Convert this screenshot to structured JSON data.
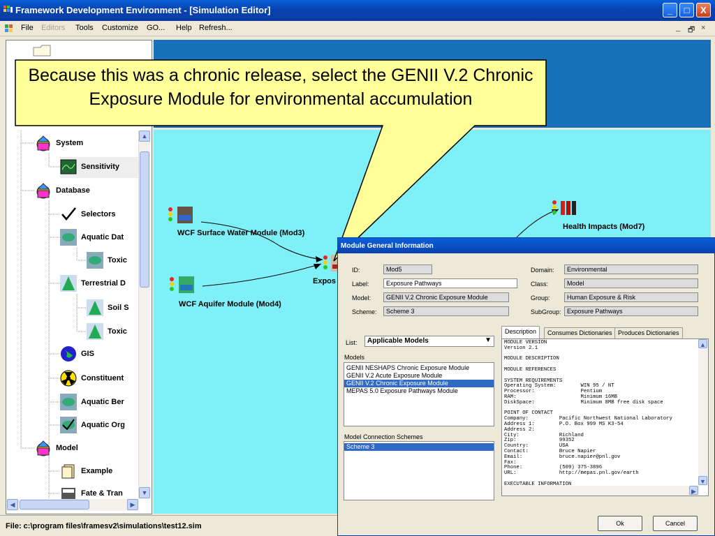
{
  "window": {
    "title": "Framework Development Environment - [Simulation Editor]",
    "minimize": "_",
    "maximize": "□",
    "close": "X"
  },
  "menu": {
    "items": [
      {
        "label": "File",
        "disabled": false
      },
      {
        "label": "Editors",
        "disabled": true
      },
      {
        "label": "Tools",
        "disabled": false
      },
      {
        "label": "Customize",
        "disabled": false
      },
      {
        "label": "GO...",
        "disabled": false
      },
      {
        "label": "Help",
        "disabled": false
      },
      {
        "label": "Refresh...",
        "disabled": false
      }
    ],
    "mdi_min": "_",
    "mdi_restore": "🗗",
    "mdi_close": "×"
  },
  "tree": {
    "items": [
      {
        "label": "System",
        "icon": "system-icon"
      },
      {
        "label": "Sensitivity",
        "icon": "sensitivity-icon"
      },
      {
        "label": "Database",
        "icon": "database-icon"
      },
      {
        "label": "Selectors",
        "icon": "checkmark-icon"
      },
      {
        "label": "Aquatic Dat",
        "icon": "fish-icon"
      },
      {
        "label": "Toxic",
        "icon": "fish-icon"
      },
      {
        "label": "Terrestrial D",
        "icon": "tree-icon"
      },
      {
        "label": "Soil S",
        "icon": "tree-icon"
      },
      {
        "label": "Toxic",
        "icon": "tree-icon"
      },
      {
        "label": "GIS",
        "icon": "globe-icon"
      },
      {
        "label": "Constituent",
        "icon": "radiation-icon"
      },
      {
        "label": "Aquatic Ber",
        "icon": "fish-icon"
      },
      {
        "label": "Aquatic Org",
        "icon": "fish-icon"
      },
      {
        "label": "Model",
        "icon": "model-icon"
      },
      {
        "label": "Example",
        "icon": "example-icon"
      },
      {
        "label": "Fate & Tran",
        "icon": "fate-icon"
      }
    ]
  },
  "canvas": {
    "nodes": [
      {
        "label": "WCF Surface Water Module (Mod3)"
      },
      {
        "label": "WCF Aquifer Module (Mod4)"
      },
      {
        "label": "Expos"
      },
      {
        "label": "Health Impacts (Mod7)"
      }
    ]
  },
  "callout": {
    "text": "Because this was a chronic release, select the GENII V.2 Chronic Exposure Module for environmental accumulation"
  },
  "status": {
    "text": "File: c:\\program files\\framesv2\\simulations\\test12.sim"
  },
  "dialog": {
    "title": "Module General Information",
    "fields": {
      "id_label": "ID:",
      "id": "Mod5",
      "label_label": "Label:",
      "label": "Exposure Pathways",
      "model_label": "Model:",
      "model": "GENII V.2 Chronic Exposure Module",
      "scheme_label": "Scheme:",
      "scheme": "Scheme 3",
      "domain_label": "Domain:",
      "domain": "Environmental",
      "class_label": "Class:",
      "class": "Model",
      "group_label": "Group:",
      "group": "Human Exposure & Risk",
      "subgroup_label": "SubGroup:",
      "subgroup": "Exposure Pathways"
    },
    "list_label": "List:",
    "list_value": "Applicable Models",
    "models_label": "Models",
    "models": [
      "GENII NESHAPS Chronic Exposure Module",
      "GENII V.2 Acute Exposure Module",
      "GENII V.2 Chronic Exposure Module",
      "MEPAS 5.0 Exposure Pathways Module"
    ],
    "selected_model_index": 2,
    "schemes_label": "Model Connection Schemes",
    "schemes": [
      "Scheme 3"
    ],
    "tabs": [
      "Description",
      "Consumes Dictionaries",
      "Produces Dictionaries"
    ],
    "description": "MODULE VERSION\nVersion 2.1\n\nMODULE DESCRIPTION\n\nMODULE REFERENCES\n\nSYSTEM REQUIREMENTS\nOperating System:        WIN 95 / NT\nProcessor:               Pentium\nRAM:                     Minimum 16MB\nDiskSpace:               Minimum 8MB free disk space\n\nPOINT OF CONTACT\nCompany:          Pacific Northwest National Laboratory\nAddress 1:        P.O. Box 999 MS K3-54\nAddress 2:\nCity:             Richland\nZip:              99352\nCountry:          USA\nContact:          Bruce Napier\nEmail:            bruce.napier@pnl.gov\nFax:\nPhone:            (509) 375-3896\nURL:              http://mepas.pnl.gov/earth\n\nEXECUTABLE INFORMATION\nTool:             False\nOnline:           False",
    "ok": "Ok",
    "cancel": "Cancel"
  }
}
